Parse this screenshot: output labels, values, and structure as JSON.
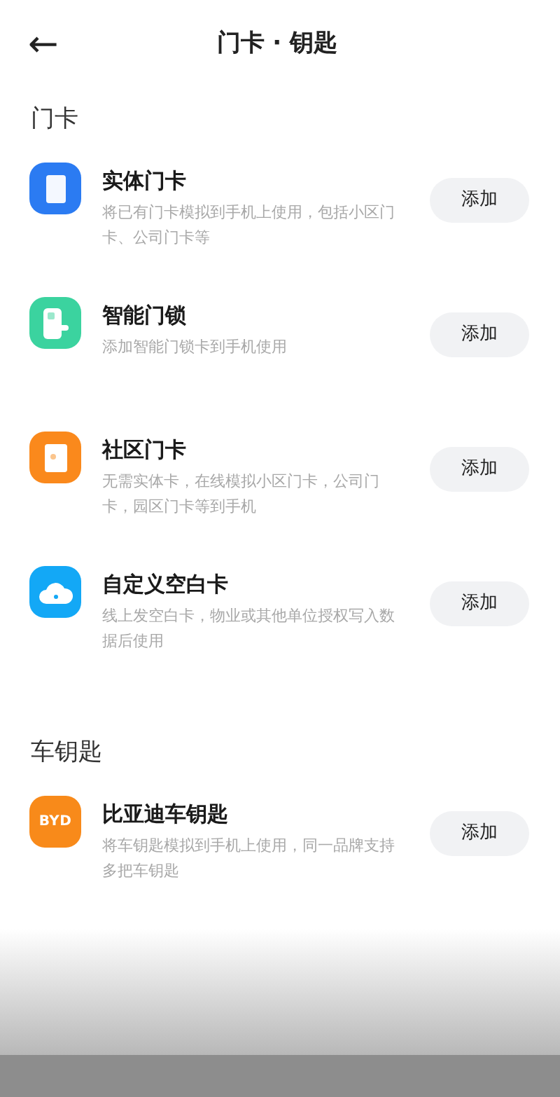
{
  "header": {
    "back": "←",
    "title": "门卡 · 钥匙"
  },
  "sections": [
    {
      "title": "门卡",
      "items": [
        {
          "kind": "card",
          "color": "#2b7bf2",
          "name": "实体门卡",
          "description": "将已有门卡模拟到手机上使用，包括小区门卡、公司门卡等",
          "button": "添加"
        },
        {
          "kind": "lock",
          "color": "#3bd39f",
          "name": "智能门锁",
          "description": "添加智能门锁卡到手机使用",
          "button": "添加"
        },
        {
          "kind": "community",
          "color": "#fa891c",
          "name": "社区门卡",
          "description": "无需实体卡，在线模拟小区门卡，公司门卡，园区门卡等到手机",
          "button": "添加"
        },
        {
          "kind": "cloud",
          "color": "#13a8f6",
          "name": "自定义空白卡",
          "description": "线上发空白卡，物业或其他单位授权写入数据后使用",
          "button": "添加"
        }
      ]
    },
    {
      "title": "车钥匙",
      "items": [
        {
          "kind": "logo",
          "color": "#f88a1a",
          "logo_text": "BYD",
          "name": "比亚迪车钥匙",
          "description": "将车钥匙模拟到手机上使用，同一品牌支持多把车钥匙",
          "button": "添加"
        }
      ]
    }
  ]
}
